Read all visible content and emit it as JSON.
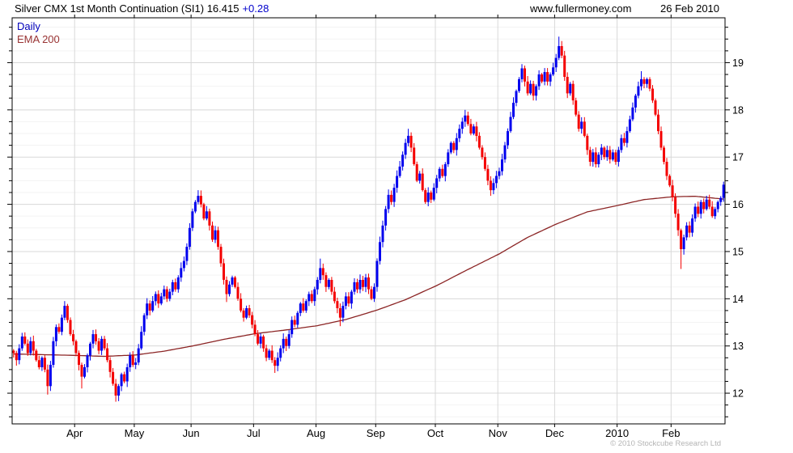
{
  "header": {
    "title": "Silver CMX 1st Month Continuation (SI1) 16.415",
    "change": "+0.28",
    "website": "www.fullermoney.com",
    "date": "26 Feb 2010"
  },
  "legend": {
    "series": "Daily",
    "overlay": "EMA 200"
  },
  "footer": {
    "copyright": "© 2010 Stockcube Research Ltd"
  },
  "chart_data": {
    "type": "candlestick",
    "title": "Silver CMX 1st Month Continuation (SI1)",
    "last_price": 16.415,
    "change": 0.28,
    "legend": [
      "Daily",
      "EMA 200"
    ],
    "y_axis": {
      "side": "right",
      "min": 11.35,
      "max": 19.95,
      "minor_step": 0.25,
      "major_ticks": [
        12,
        13,
        14,
        15,
        16,
        17,
        18,
        19
      ]
    },
    "x_axis": {
      "total_days": 251,
      "month_starts": [
        {
          "day": 22,
          "label": "Apr"
        },
        {
          "day": 43,
          "label": "May"
        },
        {
          "day": 63,
          "label": "Jun"
        },
        {
          "day": 85,
          "label": "Jul"
        },
        {
          "day": 107,
          "label": "Aug"
        },
        {
          "day": 128,
          "label": "Sep"
        },
        {
          "day": 149,
          "label": "Oct"
        },
        {
          "day": 171,
          "label": "Nov"
        },
        {
          "day": 191,
          "label": "Dec"
        },
        {
          "day": 213,
          "label": "2010"
        },
        {
          "day": 232,
          "label": "Feb"
        }
      ]
    },
    "closes": [
      12.85,
      12.7,
      12.95,
      13.2,
      13.05,
      12.85,
      13.1,
      12.9,
      12.7,
      12.55,
      12.75,
      12.5,
      12.15,
      12.6,
      13.1,
      13.4,
      13.3,
      13.6,
      13.85,
      13.55,
      13.25,
      13.1,
      12.85,
      12.6,
      12.35,
      12.55,
      12.8,
      13.05,
      13.25,
      13.1,
      12.9,
      13.15,
      12.95,
      12.7,
      12.45,
      12.2,
      11.95,
      12.15,
      12.4,
      12.25,
      12.55,
      12.8,
      12.6,
      12.65,
      12.95,
      13.3,
      13.65,
      13.9,
      13.75,
      13.95,
      14.1,
      13.9,
      14.05,
      14.2,
      14.0,
      14.15,
      14.35,
      14.2,
      14.45,
      14.65,
      14.8,
      15.1,
      15.5,
      15.85,
      16.05,
      16.18,
      16.0,
      15.7,
      15.85,
      15.55,
      15.25,
      15.45,
      15.1,
      14.75,
      14.4,
      14.1,
      14.3,
      14.45,
      14.25,
      14.0,
      13.75,
      13.6,
      13.8,
      13.65,
      13.45,
      13.25,
      13.05,
      13.2,
      12.95,
      12.75,
      12.9,
      12.7,
      12.58,
      12.75,
      12.95,
      13.15,
      13.0,
      13.25,
      13.55,
      13.45,
      13.7,
      13.9,
      13.75,
      13.95,
      14.1,
      13.95,
      14.2,
      14.4,
      14.65,
      14.5,
      14.25,
      14.4,
      14.15,
      13.95,
      13.8,
      13.6,
      13.85,
      14.05,
      13.9,
      14.15,
      14.35,
      14.2,
      14.4,
      14.25,
      14.45,
      14.2,
      14.0,
      14.25,
      14.8,
      15.2,
      15.55,
      15.9,
      16.2,
      16.05,
      16.35,
      16.6,
      16.8,
      17.05,
      17.3,
      17.45,
      17.2,
      16.85,
      16.5,
      16.65,
      16.3,
      16.05,
      16.25,
      16.1,
      16.35,
      16.55,
      16.75,
      16.6,
      16.85,
      17.1,
      17.3,
      17.15,
      17.4,
      17.6,
      17.75,
      17.88,
      17.7,
      17.5,
      17.65,
      17.45,
      17.2,
      17.0,
      16.75,
      16.5,
      16.3,
      16.45,
      16.6,
      16.7,
      16.95,
      17.25,
      17.55,
      17.85,
      18.15,
      18.4,
      18.65,
      18.88,
      18.6,
      18.35,
      18.55,
      18.3,
      18.5,
      18.75,
      18.6,
      18.8,
      18.6,
      18.75,
      18.9,
      19.1,
      19.35,
      19.15,
      18.7,
      18.35,
      18.55,
      18.2,
      17.9,
      17.6,
      17.75,
      17.45,
      17.15,
      16.9,
      17.1,
      16.85,
      17.05,
      17.2,
      17.0,
      17.15,
      16.95,
      17.1,
      16.9,
      17.15,
      17.4,
      17.3,
      17.55,
      17.8,
      18.05,
      18.3,
      18.5,
      18.65,
      18.55,
      18.65,
      18.45,
      18.2,
      17.9,
      17.55,
      17.2,
      16.9,
      16.6,
      16.4,
      16.15,
      15.8,
      15.45,
      15.05,
      15.3,
      15.55,
      15.4,
      15.7,
      15.95,
      15.8,
      16.05,
      15.9,
      16.1,
      15.95,
      15.75,
      15.9,
      16.05,
      16.135,
      16.415
    ],
    "wick_amplitude": 0.12,
    "extremes": [
      {
        "day": 12,
        "low": 11.97
      },
      {
        "day": 18,
        "high": 13.95
      },
      {
        "day": 24,
        "low": 12.1
      },
      {
        "day": 36,
        "low": 11.82
      },
      {
        "day": 65,
        "high": 16.3
      },
      {
        "day": 75,
        "low": 13.93
      },
      {
        "day": 92,
        "low": 12.43
      },
      {
        "day": 108,
        "high": 14.85
      },
      {
        "day": 115,
        "low": 13.42
      },
      {
        "day": 139,
        "high": 17.6
      },
      {
        "day": 159,
        "high": 18.0
      },
      {
        "day": 168,
        "low": 16.18
      },
      {
        "day": 192,
        "high": 19.55
      },
      {
        "day": 221,
        "high": 18.82
      },
      {
        "day": 235,
        "low": 14.63
      },
      {
        "day": 250,
        "high": 16.48
      }
    ],
    "ema_200": {
      "anchors": [
        [
          0,
          12.83
        ],
        [
          22,
          12.8
        ],
        [
          32,
          12.78
        ],
        [
          43,
          12.81
        ],
        [
          53,
          12.89
        ],
        [
          63,
          13.0
        ],
        [
          74,
          13.14
        ],
        [
          85,
          13.26
        ],
        [
          96,
          13.34
        ],
        [
          107,
          13.43
        ],
        [
          117,
          13.56
        ],
        [
          128,
          13.76
        ],
        [
          138,
          13.98
        ],
        [
          149,
          14.28
        ],
        [
          160,
          14.62
        ],
        [
          171,
          14.95
        ],
        [
          181,
          15.3
        ],
        [
          191,
          15.58
        ],
        [
          202,
          15.84
        ],
        [
          213,
          15.98
        ],
        [
          222,
          16.1
        ],
        [
          232,
          16.16
        ],
        [
          240,
          16.17
        ],
        [
          250,
          16.11
        ]
      ]
    },
    "colors": {
      "up": "#0000EE",
      "down": "#F40000",
      "ema": "#8B2424",
      "grid_major": "#D8D8D8",
      "grid_minor": "#F3F3F3",
      "axis": "#000000",
      "legend_daily": "#0000BB",
      "legend_ema": "#993333",
      "change": "#0000CC",
      "copyright": "#B4B4B4"
    }
  }
}
